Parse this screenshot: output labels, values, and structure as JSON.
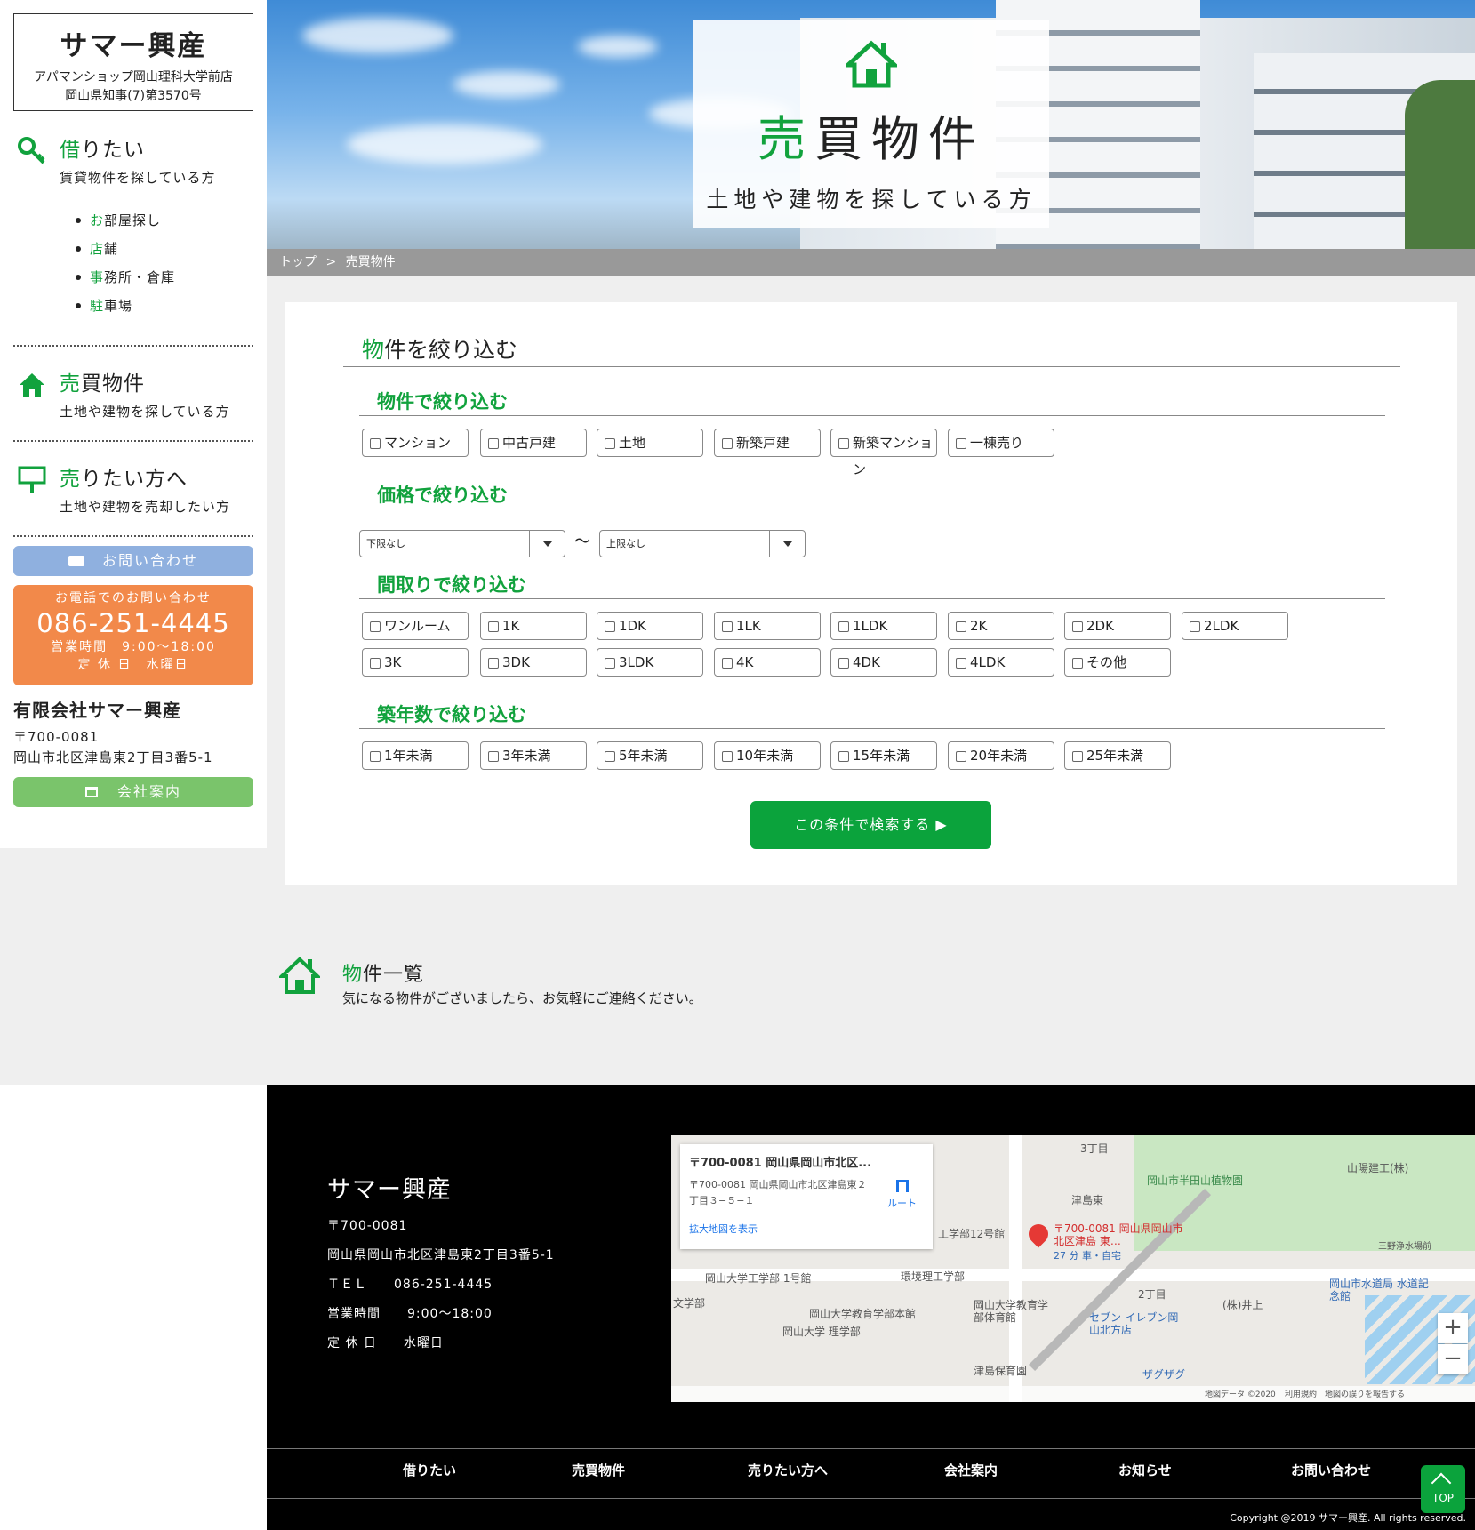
{
  "sidebar": {
    "logo_title": "サマー興産",
    "logo_sub1": "アパマンショップ岡山理科大学前店",
    "logo_sub2": "岡山県知事(7)第3570号",
    "rent": {
      "title_hl": "借",
      "title_rest": "りたい",
      "desc": "賃貸物件を探している方",
      "items": [
        {
          "hl": "お",
          "rest": "部屋探し"
        },
        {
          "hl": "店",
          "rest": "舗"
        },
        {
          "hl": "事",
          "rest": "務所・倉庫"
        },
        {
          "hl": "駐",
          "rest": "車場"
        }
      ]
    },
    "buy": {
      "title_hl": "売",
      "title_rest": "買物件",
      "desc": "土地や建物を探している方"
    },
    "sell": {
      "title_hl": "売",
      "title_rest": "りたい方へ",
      "desc": "土地や建物を売却したい方"
    },
    "contact_label": "お問い合わせ",
    "tel": {
      "label": "お電話でのお問い合わせ",
      "number": "086-251-4445",
      "hours": "営業時間　9:00〜18:00",
      "holiday": "定 休 日　水曜日"
    },
    "company": {
      "name": "有限会社サマー興産",
      "zip": "〒700-0081",
      "address": "岡山市北区津島東2丁目3番5-1",
      "button": "会社案内"
    }
  },
  "hero": {
    "title_hl": "売",
    "title_rest": "買物件",
    "subtitle": "土地や建物を探している方"
  },
  "breadcrumb": {
    "home": "トップ",
    "sep": ">",
    "current": "売買物件"
  },
  "filter": {
    "title_hl": "物",
    "title_rest": "件を絞り込む",
    "type_heading": "物件で絞り込む",
    "types": [
      "マンション",
      "中古戸建",
      "土地",
      "新築戸建",
      "新築マンション",
      "一棟売り"
    ],
    "price_heading": "価格で絞り込む",
    "price_min": "下限なし",
    "price_tilde": "〜",
    "price_max": "上限なし",
    "layout_heading": "間取りで絞り込む",
    "layouts_row1": [
      "ワンルーム",
      "1K",
      "1DK",
      "1LK",
      "1LDK",
      "2K",
      "2DK",
      "2LDK"
    ],
    "layouts_row2": [
      "3K",
      "3DK",
      "3LDK",
      "4K",
      "4DK",
      "4LDK",
      "その他"
    ],
    "age_heading": "築年数で絞り込む",
    "ages": [
      "1年未満",
      "3年未満",
      "5年未満",
      "10年未満",
      "15年未満",
      "20年未満",
      "25年未満"
    ],
    "search_button": "この条件で検索する ▶"
  },
  "listing": {
    "title_hl": "物",
    "title_rest": "件一覧",
    "desc": "気になる物件がございましたら、お気軽にご連絡ください。"
  },
  "footer": {
    "name": "サマー興産",
    "zip": "〒700-0081",
    "address": "岡山県岡山市北区津島東2丁目3番5-1",
    "tel": "ＴＥＬ　　086-251-4445",
    "hours": "営業時間　　9:00〜18:00",
    "holiday": "定 休 日　　水曜日",
    "map": {
      "card_title": "〒700-0081 岡山県岡山市北区...",
      "card_addr": "〒700-0081 岡山県岡山市北区津島東２丁目３−５−１",
      "card_link": "拡大地図を表示",
      "route": "ルート",
      "pin_label": "〒700-0081 岡山県岡山市北区津島 東…",
      "pin_sub": "27 分 車・自宅",
      "labels": [
        "3丁目",
        "山陽建工(株)",
        "岡山市半田山植物園",
        "津島東",
        "工学部12号館",
        "三野浄水場前",
        "岡山大学工学部 1号館",
        "環境理工学部",
        "2丁目",
        "(株)井上",
        "岡山市水道局 水道記念館",
        "岡山大学教育学部本館",
        "岡山大学教育学部体育館",
        "セブン-イレブン岡山北方店",
        "岡山大学 理学部",
        "文学部",
        "津島保育園",
        "ザグザグ",
        "地図データ ©2020",
        "利用規約",
        "地図の誤りを報告する"
      ]
    },
    "nav": [
      "借りたい",
      "売買物件",
      "売りたい方へ",
      "会社案内",
      "お知らせ",
      "お問い合わせ"
    ],
    "copyright": "Copyright @2019 サマー興産. All rights reserved.",
    "top": "TOP"
  },
  "colors": {
    "accent": "#11a23d",
    "button": "#0ba33c",
    "contact": "#8fb0df",
    "tel": "#f2894a",
    "company": "#7ac46b"
  }
}
